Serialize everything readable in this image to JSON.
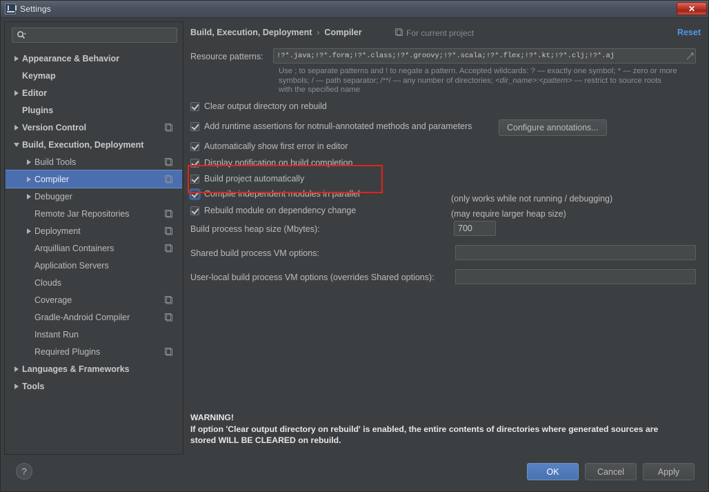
{
  "window": {
    "title": "Settings",
    "app_icon": "intellij-idea-icon",
    "close_label": "✕"
  },
  "sidebar": {
    "search": {
      "value": "",
      "placeholder": "",
      "icon": "search-icon"
    },
    "items": [
      {
        "label": "Appearance & Behavior",
        "arrow": "right",
        "indent": 0,
        "bold": true,
        "project_icon": false,
        "selected": false
      },
      {
        "label": "Keymap",
        "arrow": "none",
        "indent": 0,
        "bold": true,
        "project_icon": false,
        "selected": false
      },
      {
        "label": "Editor",
        "arrow": "right",
        "indent": 0,
        "bold": true,
        "project_icon": false,
        "selected": false
      },
      {
        "label": "Plugins",
        "arrow": "none",
        "indent": 0,
        "bold": true,
        "project_icon": false,
        "selected": false
      },
      {
        "label": "Version Control",
        "arrow": "right",
        "indent": 0,
        "bold": true,
        "project_icon": true,
        "selected": false
      },
      {
        "label": "Build, Execution, Deployment",
        "arrow": "down",
        "indent": 0,
        "bold": true,
        "project_icon": false,
        "selected": false
      },
      {
        "label": "Build Tools",
        "arrow": "right",
        "indent": 1,
        "bold": false,
        "project_icon": true,
        "selected": false
      },
      {
        "label": "Compiler",
        "arrow": "right",
        "indent": 1,
        "bold": false,
        "project_icon": true,
        "selected": true
      },
      {
        "label": "Debugger",
        "arrow": "right",
        "indent": 1,
        "bold": false,
        "project_icon": false,
        "selected": false
      },
      {
        "label": "Remote Jar Repositories",
        "arrow": "none",
        "indent": 1,
        "bold": false,
        "project_icon": true,
        "selected": false
      },
      {
        "label": "Deployment",
        "arrow": "right",
        "indent": 1,
        "bold": false,
        "project_icon": true,
        "selected": false
      },
      {
        "label": "Arquillian Containers",
        "arrow": "none",
        "indent": 1,
        "bold": false,
        "project_icon": true,
        "selected": false
      },
      {
        "label": "Application Servers",
        "arrow": "none",
        "indent": 1,
        "bold": false,
        "project_icon": false,
        "selected": false
      },
      {
        "label": "Clouds",
        "arrow": "none",
        "indent": 1,
        "bold": false,
        "project_icon": false,
        "selected": false
      },
      {
        "label": "Coverage",
        "arrow": "none",
        "indent": 1,
        "bold": false,
        "project_icon": true,
        "selected": false
      },
      {
        "label": "Gradle-Android Compiler",
        "arrow": "none",
        "indent": 1,
        "bold": false,
        "project_icon": true,
        "selected": false
      },
      {
        "label": "Instant Run",
        "arrow": "none",
        "indent": 1,
        "bold": false,
        "project_icon": false,
        "selected": false
      },
      {
        "label": "Required Plugins",
        "arrow": "none",
        "indent": 1,
        "bold": false,
        "project_icon": true,
        "selected": false
      },
      {
        "label": "Languages & Frameworks",
        "arrow": "right",
        "indent": 0,
        "bold": true,
        "project_icon": false,
        "selected": false
      },
      {
        "label": "Tools",
        "arrow": "right",
        "indent": 0,
        "bold": true,
        "project_icon": false,
        "selected": false
      }
    ]
  },
  "header": {
    "breadcrumb_root": "Build, Execution, Deployment",
    "breadcrumb_sep": "›",
    "breadcrumb_leaf": "Compiler",
    "for_project_label": "For current project",
    "for_project_icon": "project-scope-icon",
    "reset_label": "Reset",
    "reset_color": "#5394ec"
  },
  "resource_patterns": {
    "label": "Resource patterns:",
    "value": "!?*.java;!?*.form;!?*.class;!?*.groovy;!?*.scala;!?*.flex;!?*.kt;!?*.clj;!?*.aj",
    "expand_icon": "expand-editor-icon",
    "help_line1": "Use ; to separate patterns and ! to negate a pattern. Accepted wildcards: ? — exactly one symbol; * — zero or more",
    "help_line2_a": "symbols; / — path separator; /**/ — any number of directories; ",
    "help_line2_i": "<dir_name>:<pattern>",
    "help_line2_b": " — restrict to source roots",
    "help_line3": "with the specified name"
  },
  "options": [
    {
      "label": "Clear output directory on rebuild",
      "checked": true,
      "focused": false
    },
    {
      "label": "Add runtime assertions for notnull-annotated methods and parameters",
      "checked": true,
      "focused": false
    },
    {
      "label": "Automatically show first error in editor",
      "checked": true,
      "focused": false
    },
    {
      "label": "Display notification on build completion",
      "checked": true,
      "focused": false
    },
    {
      "label": "Build project automatically",
      "checked": true,
      "focused": false
    },
    {
      "label": "Compile independent modules in parallel",
      "checked": true,
      "focused": true
    },
    {
      "label": "Rebuild module on dependency change",
      "checked": true,
      "focused": false
    }
  ],
  "configure_annotations_button": "Configure annotations...",
  "notes": {
    "build_auto": "(only works while not running / debugging)",
    "parallel": "(may require larger heap size)"
  },
  "highlight": {
    "color": "#e32319"
  },
  "fields": {
    "heap_label": "Build process heap size (Mbytes):",
    "heap_value": "700",
    "shared_vm_label": "Shared build process VM options:",
    "shared_vm_value": "",
    "userlocal_vm_label": "User-local build process VM options (overrides Shared options):",
    "userlocal_vm_value": ""
  },
  "warning": {
    "line1": "WARNING!",
    "line2": "If option 'Clear output directory on rebuild' is enabled, the entire contents of directories where generated sources are",
    "line3": "stored WILL BE CLEARED on rebuild."
  },
  "footer": {
    "help_label": "?",
    "ok_label": "OK",
    "cancel_label": "Cancel",
    "apply_label": "Apply"
  }
}
